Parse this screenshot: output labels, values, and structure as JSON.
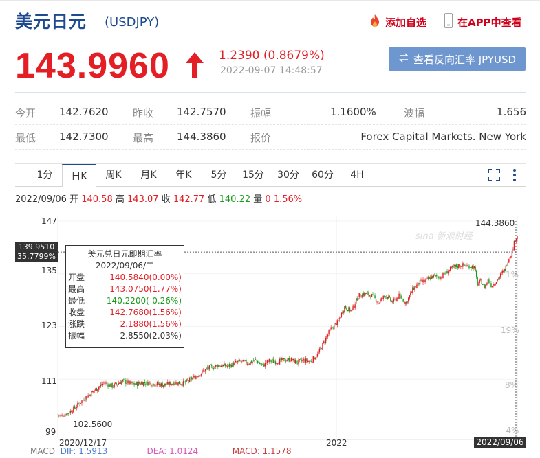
{
  "header": {
    "title": "美元日元",
    "symbol": "(USDJPY)",
    "add_fav": "添加自选",
    "app_view": "在APP中查看"
  },
  "quote": {
    "price": "143.9960",
    "change": "1.2390 (0.8679%)",
    "timestamp": "2022-09-07 14:48:57",
    "reverse_button": "查看反向汇率 JPYUSD"
  },
  "stats": {
    "open_label": "今开",
    "open_value": "142.7620",
    "prev_label": "昨收",
    "prev_value": "142.7570",
    "amp_label": "振幅",
    "amp_value": "1.1600%",
    "wave_label": "波幅",
    "wave_value": "1.656",
    "low_label": "最低",
    "low_value": "142.7300",
    "high_label": "最高",
    "high_value": "144.3860",
    "quote_label": "报价",
    "quote_value": "Forex Capital Markets. New York"
  },
  "tabs": [
    "1分",
    "日K",
    "周K",
    "月K",
    "年K",
    "5分",
    "15分",
    "30分",
    "60分",
    "4H"
  ],
  "active_tab": 1,
  "ohlc": {
    "date": "2022/09/06",
    "open_label": "开",
    "open": "140.58",
    "high_label": "高",
    "high": "143.07",
    "close_label": "收",
    "close": "142.77",
    "low_label": "低",
    "low": "140.22",
    "vol_label": "量",
    "vol": "0",
    "pct": "1.56%"
  },
  "chart_data": {
    "type": "candlestick",
    "title": "",
    "xlabel": "",
    "ylabel": "",
    "ylim": [
      99,
      147
    ],
    "yticks": [
      "147",
      "135",
      "123",
      "111",
      "99"
    ],
    "pct_ticks": [
      "1%",
      "19%",
      "8%",
      "-4%"
    ],
    "x_labels": [
      "2020/12/17",
      "2022",
      "2022/09/06"
    ],
    "crosshair_price": "139.9510",
    "crosshair_pct": "35.7799%",
    "max_label": "144.3860",
    "min_label": "102.5600",
    "colors": {
      "up": "#e31e24",
      "down": "#1a9a1a"
    },
    "close_path": [
      [
        0,
        102.9
      ],
      [
        5,
        102.6
      ],
      [
        15,
        103.3
      ],
      [
        25,
        104.5
      ],
      [
        40,
        106.8
      ],
      [
        55,
        108.6
      ],
      [
        68,
        110.2
      ],
      [
        80,
        109.4
      ],
      [
        95,
        110.6
      ],
      [
        110,
        109.8
      ],
      [
        125,
        110.2
      ],
      [
        140,
        110.0
      ],
      [
        155,
        109.7
      ],
      [
        170,
        110.2
      ],
      [
        185,
        110.1
      ],
      [
        200,
        111.5
      ],
      [
        220,
        113.5
      ],
      [
        235,
        114.2
      ],
      [
        250,
        114.0
      ],
      [
        265,
        115.0
      ],
      [
        280,
        114.7
      ],
      [
        290,
        115.3
      ],
      [
        300,
        114.1
      ],
      [
        310,
        115.2
      ],
      [
        320,
        115.0
      ],
      [
        330,
        115.3
      ],
      [
        340,
        115.5
      ],
      [
        350,
        114.8
      ],
      [
        360,
        115.3
      ],
      [
        370,
        115.1
      ],
      [
        380,
        116.5
      ],
      [
        390,
        119.5
      ],
      [
        400,
        122.5
      ],
      [
        410,
        124.0
      ],
      [
        420,
        127.5
      ],
      [
        430,
        126.5
      ],
      [
        440,
        130.0
      ],
      [
        450,
        130.5
      ],
      [
        460,
        130.0
      ],
      [
        470,
        128.5
      ],
      [
        480,
        130.2
      ],
      [
        490,
        128.5
      ],
      [
        500,
        130.0
      ],
      [
        510,
        128.3
      ],
      [
        520,
        131.5
      ],
      [
        530,
        133.0
      ],
      [
        540,
        133.5
      ],
      [
        550,
        134.5
      ],
      [
        560,
        134.2
      ],
      [
        570,
        135.5
      ],
      [
        580,
        136.5
      ],
      [
        590,
        137.0
      ],
      [
        600,
        136.8
      ],
      [
        610,
        136.5
      ],
      [
        615,
        132.5
      ],
      [
        620,
        133.5
      ],
      [
        625,
        131.8
      ],
      [
        630,
        133.5
      ],
      [
        635,
        132.4
      ],
      [
        640,
        133.0
      ],
      [
        645,
        134.0
      ],
      [
        650,
        135.0
      ],
      [
        655,
        136.0
      ],
      [
        660,
        138.5
      ],
      [
        665,
        139.8
      ],
      [
        670,
        143.0
      ],
      [
        673,
        143.7
      ]
    ]
  },
  "tooltip": {
    "title": "美元兑日元即期汇率",
    "date": "2022/09/06/二",
    "rows": [
      {
        "k": "开盘",
        "v": "140.5840(0.00%)",
        "c": "r"
      },
      {
        "k": "最高",
        "v": "143.0750(1.77%)",
        "c": "r"
      },
      {
        "k": "最低",
        "v": "140.2200(-0.26%)",
        "c": "g"
      },
      {
        "k": "收盘",
        "v": "142.7680(1.56%)",
        "c": "r"
      },
      {
        "k": "涨跌",
        "v": "2.1880(1.56%)",
        "c": "r"
      },
      {
        "k": "振幅",
        "v": "2.8550(2.03%)",
        "c": "d"
      }
    ]
  },
  "macd": {
    "label": "MACD",
    "dif": "DIF: 1.5913",
    "dea": "DEA: 1.0124",
    "macd": "MACD: 1.1578"
  },
  "watermark": "sina 新浪财经"
}
